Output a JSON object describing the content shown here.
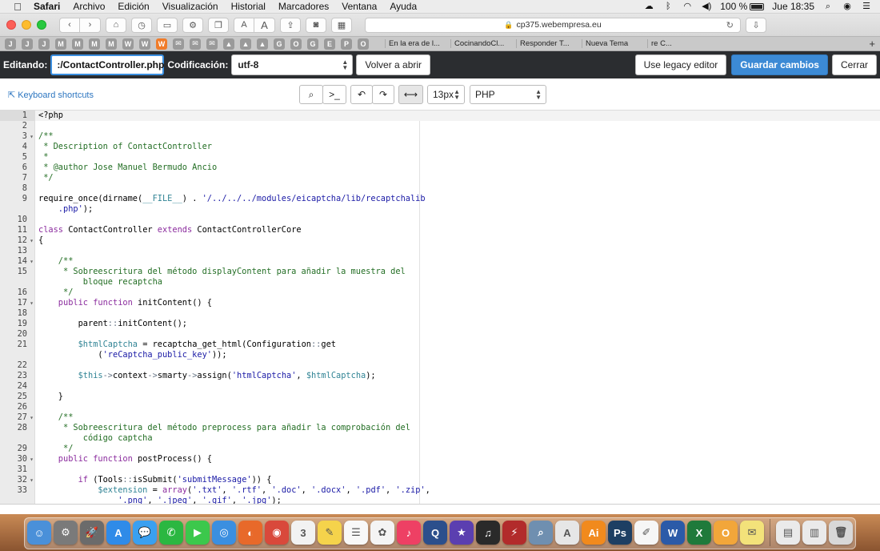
{
  "menubar": {
    "app": "Safari",
    "items": [
      "Archivo",
      "Edición",
      "Visualización",
      "Historial",
      "Marcadores",
      "Ventana",
      "Ayuda"
    ],
    "battery": "100 %",
    "clock": "Jue 18:35"
  },
  "browser": {
    "url": "cp375.webempresa.eu",
    "text_size_small": "A",
    "text_size_large": "A"
  },
  "tabs": {
    "favicons": [
      {
        "letter": "J",
        "color": "#9a9a9a"
      },
      {
        "letter": "J",
        "color": "#9a9a9a"
      },
      {
        "letter": "J",
        "color": "#9a9a9a"
      },
      {
        "letter": "M",
        "color": "#9a9a9a"
      },
      {
        "letter": "M",
        "color": "#9a9a9a"
      },
      {
        "letter": "M",
        "color": "#9a9a9a"
      },
      {
        "letter": "M",
        "color": "#9a9a9a"
      },
      {
        "letter": "W",
        "color": "#9a9a9a"
      },
      {
        "letter": "W",
        "color": "#9a9a9a"
      },
      {
        "letter": "W",
        "color": "#f07c2a"
      },
      {
        "letter": "✉",
        "color": "#9a9a9a"
      },
      {
        "letter": "✉",
        "color": "#9a9a9a"
      },
      {
        "letter": "✉",
        "color": "#9a9a9a"
      },
      {
        "letter": "▲",
        "color": "#9a9a9a"
      },
      {
        "letter": "▲",
        "color": "#9a9a9a"
      },
      {
        "letter": "▲",
        "color": "#9a9a9a"
      },
      {
        "letter": "G",
        "color": "#9a9a9a"
      },
      {
        "letter": "O",
        "color": "#9a9a9a"
      },
      {
        "letter": "G",
        "color": "#9a9a9a"
      },
      {
        "letter": "E",
        "color": "#9a9a9a"
      },
      {
        "letter": "P",
        "color": "#9a9a9a"
      },
      {
        "letter": "O",
        "color": "#9a9a9a"
      }
    ],
    "titled": [
      "En la era de l...",
      "CocinandoCl...",
      "Responder T...",
      "Nueva Tema",
      "re C..."
    ]
  },
  "editor_header": {
    "editing_label": "Editando:",
    "filename": ":/ContactController.php",
    "encoding_label": "Codificación:",
    "encoding_value": "utf-8",
    "reopen_button": "Volver a abrir",
    "legacy_button": "Use legacy editor",
    "save_button": "Guardar cambios",
    "close_button": "Cerrar"
  },
  "editor_controls": {
    "shortcuts_link": "Keyboard shortcuts",
    "font_size": "13px",
    "language": "PHP"
  },
  "code_lines": [
    {
      "n": "1",
      "fold": false,
      "active": true,
      "tokens": [
        [
          "plain",
          "<?php"
        ]
      ]
    },
    {
      "n": "2",
      "fold": false,
      "tokens": []
    },
    {
      "n": "3",
      "fold": true,
      "tokens": [
        [
          "cm",
          "/**"
        ]
      ]
    },
    {
      "n": "4",
      "fold": false,
      "tokens": [
        [
          "cm",
          " * Description of ContactController"
        ]
      ]
    },
    {
      "n": "5",
      "fold": false,
      "tokens": [
        [
          "cm",
          " *"
        ]
      ]
    },
    {
      "n": "6",
      "fold": false,
      "tokens": [
        [
          "cm",
          " * @author Jose Manuel Bermudo Ancio"
        ]
      ]
    },
    {
      "n": "7",
      "fold": false,
      "tokens": [
        [
          "cm",
          " */"
        ]
      ]
    },
    {
      "n": "8",
      "fold": false,
      "tokens": []
    },
    {
      "n": "9",
      "fold": false,
      "tokens": [
        [
          "plain",
          "require_once(dirname("
        ],
        [
          "var",
          "__FILE__"
        ],
        [
          "plain",
          ") . "
        ],
        [
          "str",
          "'/../../../modules/eicaptcha/lib/recaptchalib"
        ]
      ]
    },
    {
      "n": "",
      "fold": false,
      "tokens": [
        [
          "str",
          "    .php'"
        ],
        [
          "plain",
          ");"
        ]
      ]
    },
    {
      "n": "10",
      "fold": false,
      "tokens": []
    },
    {
      "n": "11",
      "fold": false,
      "tokens": [
        [
          "kw",
          "class"
        ],
        [
          "plain",
          " ContactController "
        ],
        [
          "kw",
          "extends"
        ],
        [
          "plain",
          " ContactControllerCore"
        ]
      ]
    },
    {
      "n": "12",
      "fold": true,
      "tokens": [
        [
          "plain",
          "{"
        ]
      ]
    },
    {
      "n": "13",
      "fold": false,
      "tokens": []
    },
    {
      "n": "14",
      "fold": true,
      "tokens": [
        [
          "cm",
          "    /**"
        ]
      ]
    },
    {
      "n": "15",
      "fold": false,
      "tokens": [
        [
          "cm",
          "     * Sobreescritura del método displayContent para añadir la muestra del"
        ]
      ]
    },
    {
      "n": "",
      "fold": false,
      "tokens": [
        [
          "cm",
          "         bloque recaptcha"
        ]
      ]
    },
    {
      "n": "16",
      "fold": false,
      "tokens": [
        [
          "cm",
          "     */"
        ]
      ]
    },
    {
      "n": "17",
      "fold": true,
      "tokens": [
        [
          "kw",
          "    public"
        ],
        [
          "plain",
          " "
        ],
        [
          "kw",
          "function"
        ],
        [
          "plain",
          " initContent() {"
        ]
      ]
    },
    {
      "n": "18",
      "fold": false,
      "tokens": []
    },
    {
      "n": "19",
      "fold": false,
      "tokens": [
        [
          "plain",
          "        parent"
        ],
        [
          "op",
          "::"
        ],
        [
          "plain",
          "initContent();"
        ]
      ]
    },
    {
      "n": "20",
      "fold": false,
      "tokens": []
    },
    {
      "n": "21",
      "fold": false,
      "tokens": [
        [
          "var",
          "        $htmlCaptcha"
        ],
        [
          "plain",
          " = recaptcha_get_html(Configuration"
        ],
        [
          "op",
          "::"
        ],
        [
          "plain",
          "get"
        ]
      ]
    },
    {
      "n": "",
      "fold": false,
      "tokens": [
        [
          "plain",
          "            ("
        ],
        [
          "str",
          "'reCaptcha_public_key'"
        ],
        [
          "plain",
          "));"
        ]
      ]
    },
    {
      "n": "22",
      "fold": false,
      "tokens": []
    },
    {
      "n": "23",
      "fold": false,
      "tokens": [
        [
          "var",
          "        $this"
        ],
        [
          "op",
          "->"
        ],
        [
          "plain",
          "context"
        ],
        [
          "op",
          "->"
        ],
        [
          "plain",
          "smarty"
        ],
        [
          "op",
          "->"
        ],
        [
          "plain",
          "assign("
        ],
        [
          "str",
          "'htmlCaptcha'"
        ],
        [
          "plain",
          ", "
        ],
        [
          "var",
          "$htmlCaptcha"
        ],
        [
          "plain",
          ");"
        ]
      ]
    },
    {
      "n": "24",
      "fold": false,
      "tokens": []
    },
    {
      "n": "25",
      "fold": false,
      "tokens": [
        [
          "plain",
          "    }"
        ]
      ]
    },
    {
      "n": "26",
      "fold": false,
      "tokens": []
    },
    {
      "n": "27",
      "fold": true,
      "tokens": [
        [
          "cm",
          "    /**"
        ]
      ]
    },
    {
      "n": "28",
      "fold": false,
      "tokens": [
        [
          "cm",
          "     * Sobreescritura del método preprocess para añadir la comprobación del"
        ]
      ]
    },
    {
      "n": "",
      "fold": false,
      "tokens": [
        [
          "cm",
          "         código captcha"
        ]
      ]
    },
    {
      "n": "29",
      "fold": false,
      "tokens": [
        [
          "cm",
          "     */"
        ]
      ]
    },
    {
      "n": "30",
      "fold": true,
      "tokens": [
        [
          "kw",
          "    public"
        ],
        [
          "plain",
          " "
        ],
        [
          "kw",
          "function"
        ],
        [
          "plain",
          " postProcess() {"
        ]
      ]
    },
    {
      "n": "31",
      "fold": false,
      "tokens": []
    },
    {
      "n": "32",
      "fold": true,
      "tokens": [
        [
          "kw",
          "        if"
        ],
        [
          "plain",
          " (Tools"
        ],
        [
          "op",
          "::"
        ],
        [
          "plain",
          "isSubmit("
        ],
        [
          "str",
          "'submitMessage'"
        ],
        [
          "plain",
          ")) {"
        ]
      ]
    },
    {
      "n": "33",
      "fold": false,
      "tokens": [
        [
          "var",
          "            $extension"
        ],
        [
          "plain",
          " = "
        ],
        [
          "kw",
          "array"
        ],
        [
          "plain",
          "("
        ],
        [
          "str",
          "'.txt'"
        ],
        [
          "plain",
          ", "
        ],
        [
          "str",
          "'.rtf'"
        ],
        [
          "plain",
          ", "
        ],
        [
          "str",
          "'.doc'"
        ],
        [
          "plain",
          ", "
        ],
        [
          "str",
          "'.docx'"
        ],
        [
          "plain",
          ", "
        ],
        [
          "str",
          "'.pdf'"
        ],
        [
          "plain",
          ", "
        ],
        [
          "str",
          "'.zip'"
        ],
        [
          "plain",
          ","
        ]
      ]
    },
    {
      "n": "",
      "fold": false,
      "tokens": [
        [
          "str",
          "                '.png'"
        ],
        [
          "plain",
          ", "
        ],
        [
          "str",
          "'.jpeg'"
        ],
        [
          "plain",
          ", "
        ],
        [
          "str",
          "'.gif'"
        ],
        [
          "plain",
          ", "
        ],
        [
          "str",
          "'.jpg'"
        ],
        [
          "plain",
          ");"
        ]
      ]
    }
  ],
  "dock": {
    "apps": [
      {
        "icon": "finder-icon",
        "glyph": "☺",
        "color": "#4a90d9"
      },
      {
        "icon": "system-preferences-icon",
        "glyph": "⚙",
        "color": "#7a7a7a"
      },
      {
        "icon": "launchpad-icon",
        "glyph": "🚀",
        "color": "#6b6b6b"
      },
      {
        "icon": "app-store-icon",
        "glyph": "A",
        "color": "#2f8be8"
      },
      {
        "icon": "messages-icon",
        "glyph": "💬",
        "color": "#3aa0f0"
      },
      {
        "icon": "whatsapp-icon",
        "glyph": "✆",
        "color": "#2bb741"
      },
      {
        "icon": "facetime-icon",
        "glyph": "▶",
        "color": "#3cc84c"
      },
      {
        "icon": "safari-icon",
        "glyph": "◎",
        "color": "#3b8fe0"
      },
      {
        "icon": "firefox-icon",
        "glyph": "◐",
        "color": "#e8692a"
      },
      {
        "icon": "chrome-icon",
        "glyph": "◉",
        "color": "#d9493b"
      },
      {
        "icon": "calendar-icon",
        "glyph": "3",
        "color": "#f2f2f2"
      },
      {
        "icon": "notes-icon",
        "glyph": "✎",
        "color": "#f5d34b"
      },
      {
        "icon": "reminders-icon",
        "glyph": "☰",
        "color": "#f8f8f8"
      },
      {
        "icon": "photos-icon",
        "glyph": "✿",
        "color": "#f4f4f4"
      },
      {
        "icon": "music-icon",
        "glyph": "♪",
        "color": "#ee4064"
      },
      {
        "icon": "quicktime-icon",
        "glyph": "Q",
        "color": "#2b4f8c"
      },
      {
        "icon": "imovie-icon",
        "glyph": "★",
        "color": "#5b3fb0"
      },
      {
        "icon": "scrobbler-icon",
        "glyph": "♫",
        "color": "#2a2a2a"
      },
      {
        "icon": "filezilla-icon",
        "glyph": "⚡",
        "color": "#b22b2b"
      },
      {
        "icon": "preview-icon",
        "glyph": "⌕",
        "color": "#6f8fb0"
      },
      {
        "icon": "acrobat-icon",
        "glyph": "A",
        "color": "#e6e6e6"
      },
      {
        "icon": "illustrator-icon",
        "glyph": "Ai",
        "color": "#f18a1d"
      },
      {
        "icon": "photoshop-icon",
        "glyph": "Ps",
        "color": "#1d3f63"
      },
      {
        "icon": "textedit-icon",
        "glyph": "✐",
        "color": "#f6f6f6"
      },
      {
        "icon": "word-icon",
        "glyph": "W",
        "color": "#2b5aa8"
      },
      {
        "icon": "excel-icon",
        "glyph": "X",
        "color": "#1f7a3b"
      },
      {
        "icon": "outlook-icon",
        "glyph": "O",
        "color": "#f2a63a"
      },
      {
        "icon": "stickies-icon",
        "glyph": "✉",
        "color": "#f3e27a"
      },
      {
        "icon": "downloads-icon",
        "glyph": "▤",
        "color": "#eaeaea"
      },
      {
        "icon": "documents-icon",
        "glyph": "▥",
        "color": "#eaeaea"
      },
      {
        "icon": "trash-icon",
        "glyph": "🗑",
        "color": "#d8d8d8"
      }
    ]
  }
}
